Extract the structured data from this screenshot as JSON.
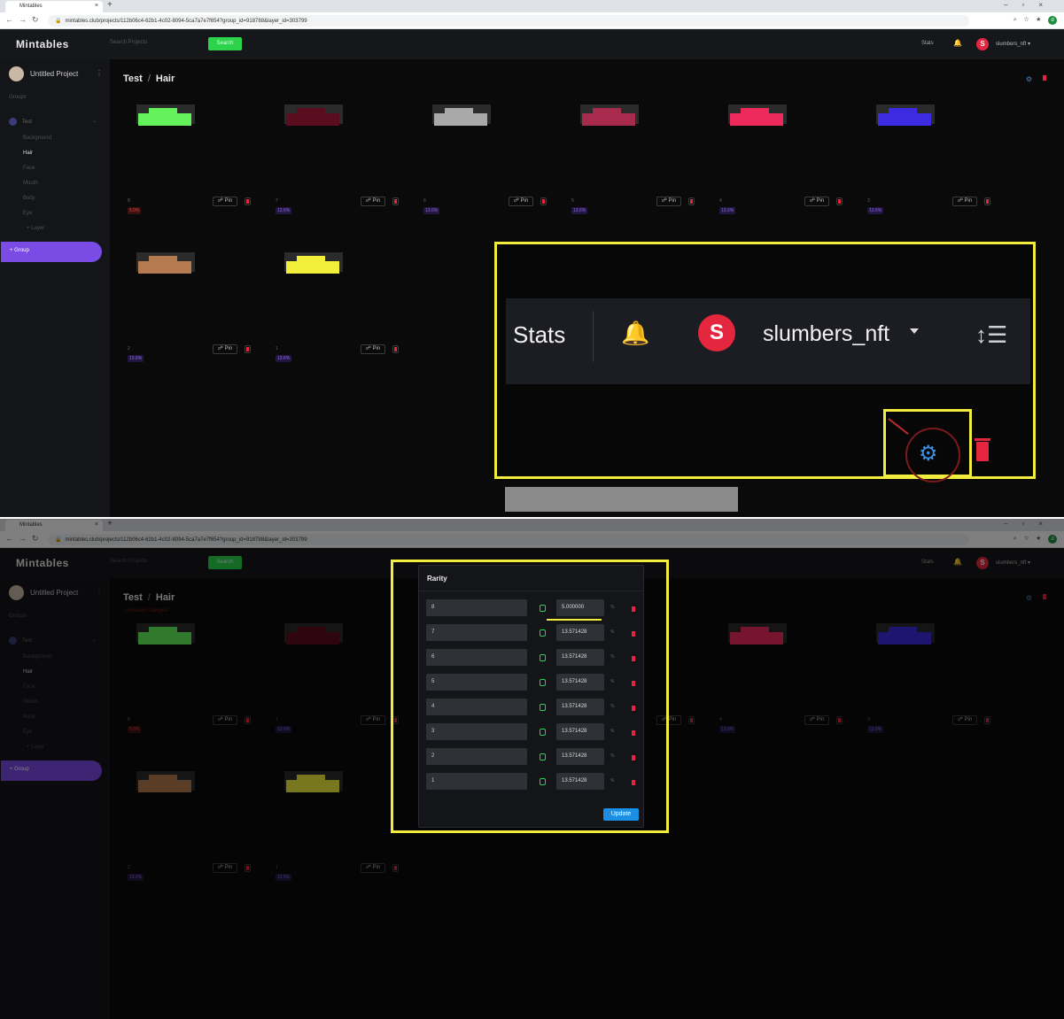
{
  "browser": {
    "tab_title": "Mintables",
    "url": "mintables.club/projects/112b06c4-62b1-4c02-8094-5ca7a7e7f654?group_id=918788&layer_id=303799"
  },
  "app": {
    "brand": "Mintables",
    "search_placeholder": "Search Projects",
    "search_button": "Search",
    "stats": "Stats",
    "user_initial": "S",
    "username": "slumbers_nft"
  },
  "sidebar": {
    "project_name": "Untitled Project",
    "groups_header": "Groups",
    "group_name": "Test",
    "layers": [
      "Background",
      "Hair",
      "Face",
      "Mouth",
      "Body",
      "Eye",
      "+ Layer"
    ],
    "add_group": "+ Group"
  },
  "main": {
    "crumb_group": "Test",
    "crumb_sep": "/",
    "crumb_layer": "Hair",
    "unsaved": "Unsaved changes!",
    "pin_label": "Pin"
  },
  "traits": [
    {
      "name": "8",
      "pct": "5.0%",
      "color": "#63f25b",
      "pct_style": "red"
    },
    {
      "name": "7",
      "pct": "13.6%",
      "color": "#5a0d1f",
      "pct_style": "purple"
    },
    {
      "name": "6",
      "pct": "13.6%",
      "color": "#a9a9a9",
      "pct_style": "purple"
    },
    {
      "name": "5",
      "pct": "13.6%",
      "color": "#a82a4c",
      "pct_style": "purple"
    },
    {
      "name": "4",
      "pct": "13.6%",
      "color": "#ee2a5c",
      "pct_style": "purple"
    },
    {
      "name": "3",
      "pct": "13.6%",
      "color": "#3c2be0",
      "pct_style": "purple"
    },
    {
      "name": "2",
      "pct": "13.6%",
      "color": "#b57a4f",
      "pct_style": "purple"
    },
    {
      "name": "1",
      "pct": "13.6%",
      "color": "#f2ef3b",
      "pct_style": "purple"
    }
  ],
  "zoom": {
    "stats": "Stats",
    "user_initial": "S",
    "username": "slumbers_nft"
  },
  "rarity_modal": {
    "title": "Rarity",
    "percent_sign": "%",
    "update_button": "Update",
    "rows": [
      {
        "name": "8",
        "value": "5.000000"
      },
      {
        "name": "7",
        "value": "13.571428"
      },
      {
        "name": "6",
        "value": "13.571428"
      },
      {
        "name": "5",
        "value": "13.571428"
      },
      {
        "name": "4",
        "value": "13.571428"
      },
      {
        "name": "3",
        "value": "13.571428"
      },
      {
        "name": "2",
        "value": "13.571428"
      },
      {
        "name": "1",
        "value": "13.571428"
      }
    ]
  },
  "colors": {
    "accent_green": "#2bd44a",
    "accent_purple": "#7b4be6",
    "brand_red": "#e5263f",
    "highlight_yellow": "#f2ec3c",
    "update_blue": "#1b8fe3"
  }
}
